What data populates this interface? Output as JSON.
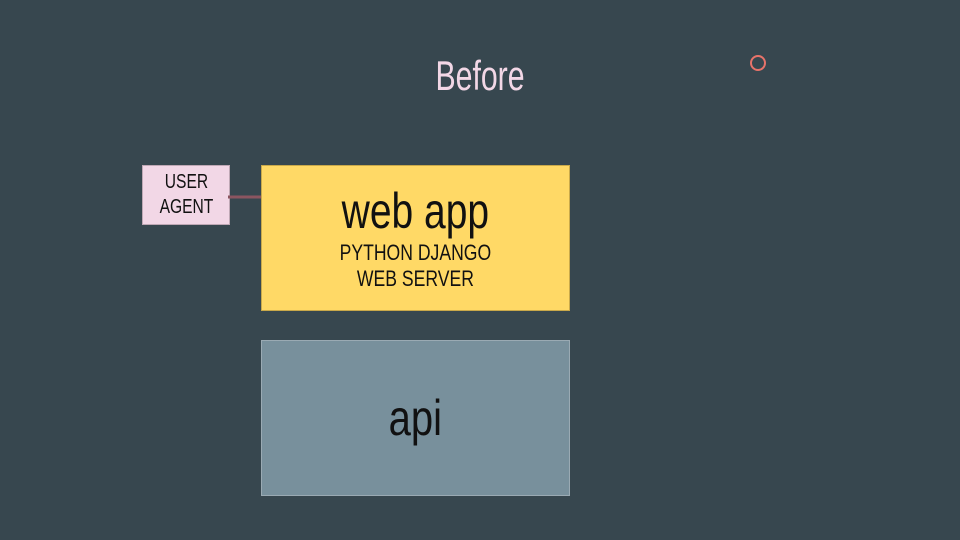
{
  "slide": {
    "title": "Before",
    "ring_color": "#e8736a"
  },
  "diagram": {
    "user_agent": {
      "label": "USER\nAGENT",
      "color": "#f2d7e6"
    },
    "web_app": {
      "title": "web app",
      "subtitle": "PYTHON DJANGO\nWEB SERVER",
      "color": "#ffd966"
    },
    "api": {
      "title": "api",
      "color": "#78909c"
    },
    "arrow": {
      "from": "user_agent",
      "to": "web_app",
      "color": "#8b5560"
    }
  }
}
